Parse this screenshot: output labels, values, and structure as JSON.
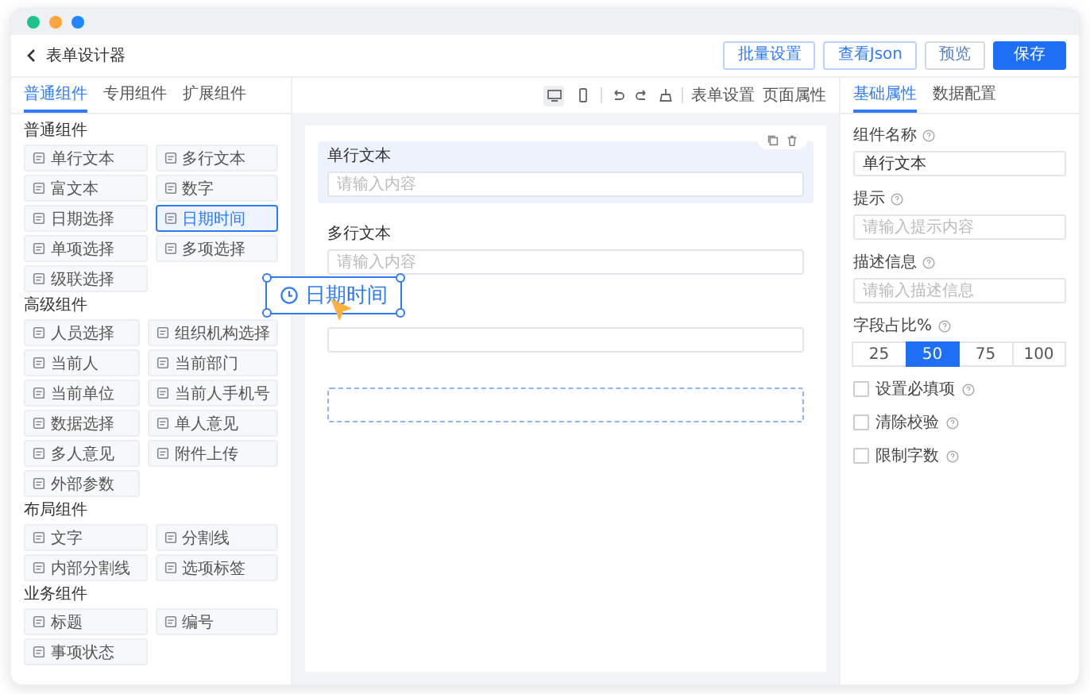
{
  "frame": {
    "dots": [
      {
        "color": "#1ec38b"
      },
      {
        "color": "#ffa53d"
      },
      {
        "color": "#1f86ff"
      }
    ]
  },
  "header": {
    "title": "表单设计器",
    "buttons": [
      {
        "label": "批量设置",
        "kind": "outline"
      },
      {
        "label": "查看Json",
        "kind": "outline"
      },
      {
        "label": "预览",
        "kind": "plain"
      },
      {
        "label": "保存",
        "kind": "primary"
      }
    ]
  },
  "palette": {
    "tabs": [
      {
        "label": "普通组件",
        "selected": true
      },
      {
        "label": "专用组件",
        "selected": false
      },
      {
        "label": "扩展组件",
        "selected": false
      }
    ],
    "groups": [
      {
        "title": "普通组件",
        "items": [
          {
            "label": "单行文本",
            "selected": false
          },
          {
            "label": "多行文本",
            "selected": false
          },
          {
            "label": "富文本",
            "selected": false
          },
          {
            "label": "数字",
            "selected": false
          },
          {
            "label": "日期选择",
            "selected": false
          },
          {
            "label": "日期时间",
            "selected": true
          },
          {
            "label": "单项选择",
            "selected": false
          },
          {
            "label": "多项选择",
            "selected": false
          },
          {
            "label": "级联选择",
            "selected": false
          }
        ]
      },
      {
        "title": "高级组件",
        "items": [
          {
            "label": "人员选择",
            "selected": false
          },
          {
            "label": "组织机构选择",
            "selected": false
          },
          {
            "label": "当前人",
            "selected": false
          },
          {
            "label": "当前部门",
            "selected": false
          },
          {
            "label": "当前单位",
            "selected": false
          },
          {
            "label": "当前人手机号",
            "selected": false
          },
          {
            "label": "数据选择",
            "selected": false
          },
          {
            "label": "单人意见",
            "selected": false
          },
          {
            "label": "多人意见",
            "selected": false
          },
          {
            "label": "附件上传",
            "selected": false
          },
          {
            "label": "外部参数",
            "selected": false
          }
        ]
      },
      {
        "title": "布局组件",
        "items": [
          {
            "label": "文字",
            "selected": false
          },
          {
            "label": "分割线",
            "selected": false
          },
          {
            "label": "内部分割线",
            "selected": false
          },
          {
            "label": "选项标签",
            "selected": false
          }
        ]
      },
      {
        "title": "业务组件",
        "items": [
          {
            "label": "标题",
            "selected": false
          },
          {
            "label": "编号",
            "selected": false
          },
          {
            "label": "事项状态",
            "selected": false
          }
        ]
      }
    ]
  },
  "toolbar": {
    "devices": [
      {
        "kind": "desktop",
        "selected": true
      },
      {
        "kind": "mobile",
        "selected": false
      }
    ],
    "actions": [
      {
        "kind": "undo"
      },
      {
        "kind": "redo"
      },
      {
        "kind": "clear"
      }
    ],
    "links": [
      "表单设置",
      "页面属性"
    ]
  },
  "canvas": {
    "fields": [
      {
        "label": "单行文本",
        "placeholder": "请输入内容",
        "selected": true
      },
      {
        "label": "多行文本",
        "placeholder": "请输入内容",
        "selected": false
      },
      {
        "selected": false
      }
    ],
    "drag_ghost": {
      "label": "日期时间"
    }
  },
  "properties": {
    "tabs": [
      {
        "label": "基础属性",
        "selected": true
      },
      {
        "label": "数据配置",
        "selected": false
      }
    ],
    "fields": [
      {
        "label": "组件名称",
        "value": "单行文本"
      },
      {
        "label": "提示",
        "placeholder": "请输入提示内容"
      },
      {
        "label": "描述信息",
        "placeholder": "请输入描述信息"
      }
    ],
    "ratio": {
      "label": "字段占比%",
      "options": [
        {
          "label": "25",
          "selected": false
        },
        {
          "label": "50",
          "selected": true
        },
        {
          "label": "75",
          "selected": false
        },
        {
          "label": "100",
          "selected": false
        }
      ]
    },
    "options": [
      {
        "label": "设置必填项",
        "checked": false
      },
      {
        "label": "清除校验",
        "checked": false
      },
      {
        "label": "限制字数",
        "checked": false
      }
    ]
  }
}
